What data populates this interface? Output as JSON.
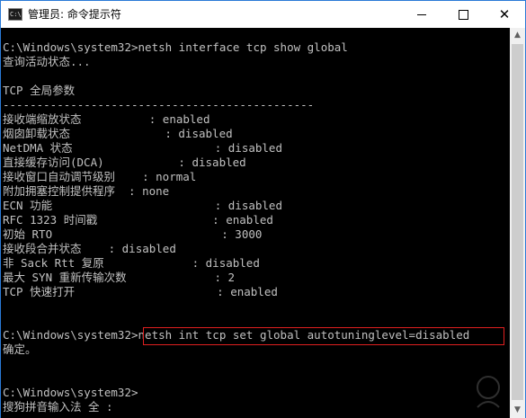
{
  "window": {
    "title": "管理员: 命令提示符",
    "app_icon": "cmd-icon",
    "controls": {
      "minimize": "minimize-icon",
      "maximize": "maximize-icon",
      "close": "close-icon"
    },
    "close_glyph": "✕"
  },
  "console": {
    "lines": [
      "C:\\Windows\\system32>netsh interface tcp show global",
      "查询活动状态...",
      "",
      "TCP 全局参数",
      "----------------------------------------------",
      "接收端缩放状态          : enabled",
      "烟囱卸载状态              : disabled",
      "NetDMA 状态                     : disabled",
      "直接缓存访问(DCA)           : disabled",
      "接收窗口自动调节级别    : normal",
      "附加拥塞控制提供程序  : none",
      "ECN 功能                        : disabled",
      "RFC 1323 时间戳                 : enabled",
      "初始 RTO                         : 3000",
      "接收段合并状态    : disabled",
      "非 Sack Rtt 复原             : disabled",
      "最大 SYN 重新传输次数             : 2",
      "TCP 快速打开                     : enabled",
      "",
      "",
      "C:\\Windows\\system32>netsh int tcp set global autotuninglevel=disabled",
      "确定。",
      "",
      "",
      "C:\\Windows\\system32>",
      "搜狗拼音输入法 全 :"
    ]
  },
  "colors": {
    "console_bg": "#000000",
    "console_text": "#c0c0c0",
    "highlight_border": "#e02020",
    "titlebar_bg": "#ffffff"
  }
}
